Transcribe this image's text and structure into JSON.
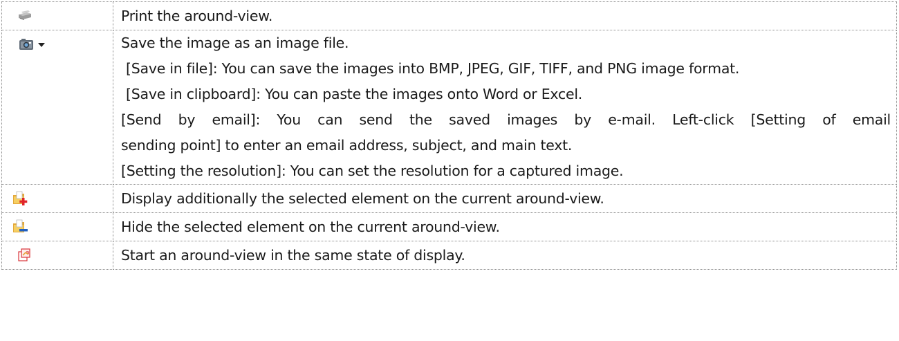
{
  "rows": [
    {
      "icon": "printer-icon",
      "lines": [
        "Print the around-view."
      ]
    },
    {
      "icon": "camera-dropdown-icon",
      "lines": [
        "Save the image as an image file.",
        "[Save in file]: You can save the images into BMP, JPEG, GIF, TIFF, and PNG image format.",
        "[Save in clipboard]: You can paste the images onto Word or Excel.",
        "[Send by email]: You can send the saved images by e-mail. Left-click [Setting of email",
        "sending point] to enter an email address, subject, and main text.",
        "[Setting the resolution]: You can set the resolution for a captured image."
      ]
    },
    {
      "icon": "add-element-icon",
      "lines": [
        "Display additionally the selected element on the current around-view."
      ]
    },
    {
      "icon": "hide-element-icon",
      "lines": [
        "Hide the selected element on the current around-view."
      ]
    },
    {
      "icon": "restart-view-icon",
      "lines": [
        "Start an around-view in the same state of display."
      ]
    }
  ],
  "colors": {
    "border": "#8a8a8a",
    "text": "#1a1a1a",
    "folder_yellow": "#f2c14e",
    "add_red": "#e0242a",
    "hide_blue": "#1f5fbf",
    "restart_red": "#d9343a"
  }
}
